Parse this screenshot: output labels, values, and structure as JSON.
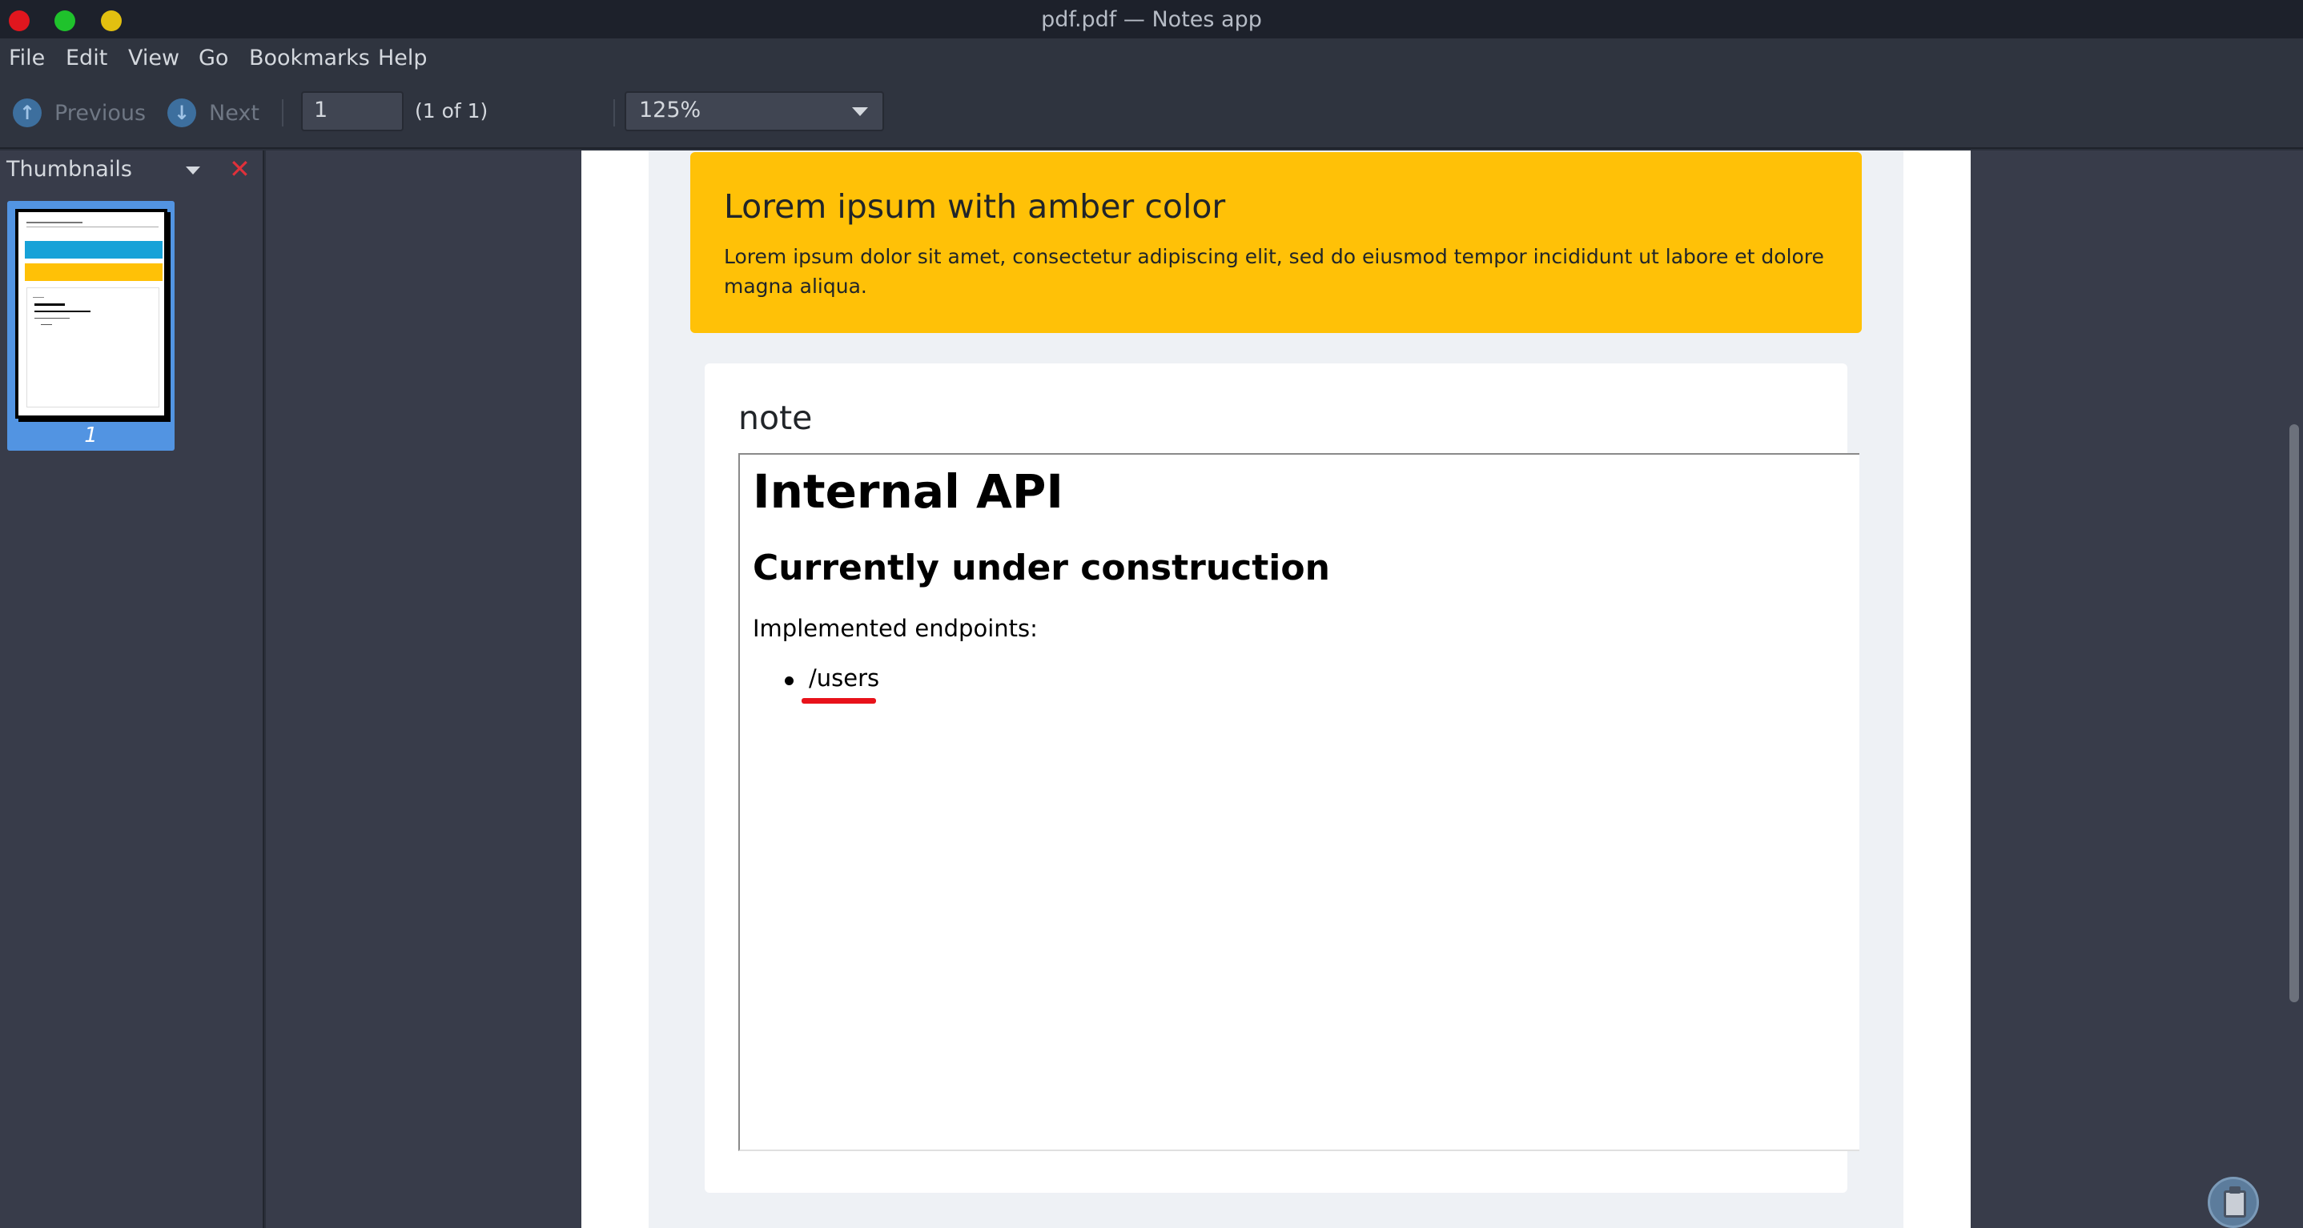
{
  "window": {
    "title": "pdf.pdf — Notes app"
  },
  "menu": {
    "items": [
      "File",
      "Edit",
      "View",
      "Go",
      "Bookmarks",
      "Help"
    ]
  },
  "toolbar": {
    "previous_label": "Previous",
    "next_label": "Next",
    "page_value": "1",
    "page_count_text": "(1 of 1)",
    "zoom_value": "125%"
  },
  "sidebar": {
    "title": "Thumbnails",
    "close_glyph": "✕",
    "thumbnails": [
      {
        "page_number": "1"
      }
    ]
  },
  "document": {
    "alert": {
      "title": "Lorem ipsum with amber color",
      "text": "Lorem ipsum dolor sit amet, consectetur adipiscing elit, sed do eiusmod tempor incididunt ut labore et dolore magna aliqua."
    },
    "note": {
      "title": "note",
      "content": {
        "heading1": "Internal API",
        "heading2": "Currently under construction",
        "paragraph": "Implemented endpoints:",
        "list": [
          "/users"
        ]
      }
    }
  },
  "colors": {
    "amber": "#ffc107",
    "selection": "#5294e2",
    "annotation_red": "#e8121a"
  },
  "icons": {
    "previous": "arrow-up-icon",
    "next": "arrow-down-icon",
    "clipboard": "clipboard-icon"
  }
}
